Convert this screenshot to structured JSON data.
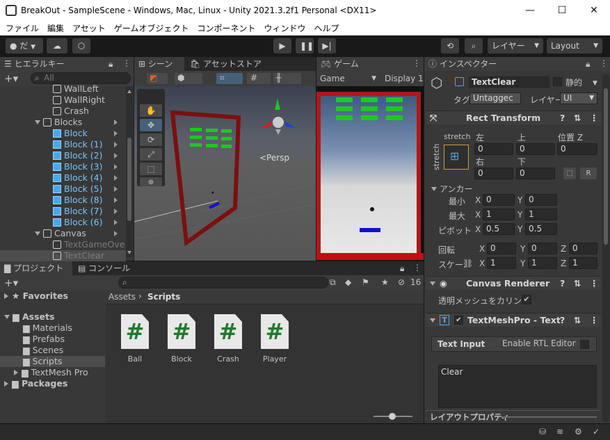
{
  "window": {
    "title": "BreakOut - SampleScene - Windows, Mac, Linux - Unity 2021.3.2f1 Personal <DX11>",
    "minimize": "—",
    "maximize": "☐",
    "close": "✕"
  },
  "menu": [
    "ファイル",
    "編集",
    "アセット",
    "ゲームオブジェクト",
    "コンポーネント",
    "ウィンドウ",
    "ヘルプ"
  ],
  "toolbar": {
    "account_label": "だ",
    "layer_label": "レイヤー",
    "layout_label": "Layout"
  },
  "hierarchy": {
    "tab": "ヒエラルキー",
    "search_placeholder": "All",
    "items": [
      {
        "label": "WallLeft",
        "kind": "white"
      },
      {
        "label": "WallRight",
        "kind": "white"
      },
      {
        "label": "Crash",
        "kind": "white"
      },
      {
        "label": "Blocks",
        "kind": "parent"
      },
      {
        "label": "Block",
        "kind": "blue"
      },
      {
        "label": "Block (1)",
        "kind": "blue"
      },
      {
        "label": "Block (2)",
        "kind": "blue"
      },
      {
        "label": "Block (3)",
        "kind": "blue"
      },
      {
        "label": "Block (4)",
        "kind": "blue"
      },
      {
        "label": "Block (5)",
        "kind": "blue"
      },
      {
        "label": "Block (8)",
        "kind": "blue"
      },
      {
        "label": "Block (7)",
        "kind": "blue"
      },
      {
        "label": "Block (6)",
        "kind": "blue"
      },
      {
        "label": "Canvas",
        "kind": "parent"
      },
      {
        "label": "TextGameOve",
        "kind": "dim"
      },
      {
        "label": "TextClear",
        "kind": "dim"
      }
    ]
  },
  "scene": {
    "tab": "シーン",
    "asset_store_tab": "アセットストア",
    "persp_label": "<Persp"
  },
  "game": {
    "tab": "ゲーム",
    "display_select": "Game",
    "display_label": "Display 1"
  },
  "inspector": {
    "tab": "インスペクター",
    "object_name": "TextClear",
    "static_label": "静的",
    "tag_label": "タグ",
    "tag_value": "Untaggec",
    "layer_label": "レイヤー",
    "layer_value": "UI",
    "rect_transform": {
      "title": "Rect Transform",
      "stretch_h": "stretch",
      "stretch_v": "stretch",
      "left_label": "左",
      "left": "0",
      "top_label": "上",
      "top": "0",
      "posz_label": "位置 Z",
      "posz": "0",
      "right_label": "右",
      "right": "0",
      "bottom_label": "下",
      "bottom": "0",
      "r_button": "R",
      "anchor_label": "アンカー",
      "min_label": "最小",
      "min_x": "0",
      "min_y": "0",
      "max_label": "最大",
      "max_x": "1",
      "max_y": "1",
      "pivot_label": "ピボット",
      "pivot_x": "0.5",
      "pivot_y": "0.5",
      "rotation_label": "回転",
      "rot_x": "0",
      "rot_y": "0",
      "rot_z": "0",
      "scale_label": "スケー.",
      "scale_x": "1",
      "scale_y": "1",
      "scale_z": "1",
      "x": "X",
      "y": "Y",
      "z": "Z"
    },
    "canvas_renderer": {
      "title": "Canvas Renderer",
      "cull_label": "透明メッシュをカリング"
    },
    "tmp": {
      "title": "TextMeshPro - Text",
      "text_input_label": "Text Input",
      "rtl_label": "Enable RTL Editor",
      "text_value": "Clear"
    },
    "layout_props": "レイアウトプロパティ"
  },
  "project": {
    "tab": "プロジェクト",
    "console_tab": "コンソール",
    "favorites": "Favorites",
    "assets": "Assets",
    "folders": [
      "Materials",
      "Prefabs",
      "Scenes",
      "Scripts",
      "TextMesh Pro"
    ],
    "packages": "Packages",
    "breadcrumb_root": "Assets",
    "breadcrumb_current": "Scripts",
    "hidden_count": "16",
    "scripts": [
      "Ball",
      "Block",
      "Crash",
      "Player"
    ]
  },
  "colors": {
    "accent_blue": "#4aa8e8",
    "selected_row": "#2c5d87",
    "wall_red": "#b01818",
    "block_green": "#1ec81e",
    "paddle_blue": "#1010d0"
  }
}
